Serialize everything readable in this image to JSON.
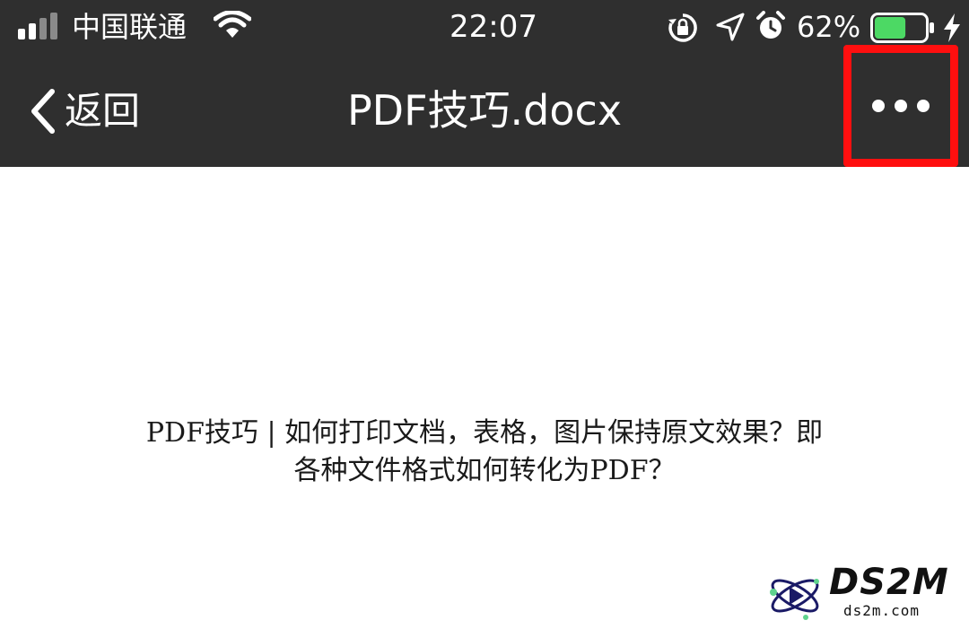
{
  "status_bar": {
    "carrier": "中国联通",
    "time": "22:07",
    "battery_percent": "62%",
    "battery_level": 0.62,
    "battery_color": "#4cd964",
    "icons": [
      "signal-icon",
      "wifi-icon",
      "orientation-lock-icon",
      "location-arrow-icon",
      "alarm-icon",
      "battery-icon",
      "charging-bolt-icon"
    ]
  },
  "nav": {
    "back_label": "返回",
    "title": "PDF技巧.docx",
    "more_icon": "ellipsis-icon",
    "highlight_color": "#ff0f0f"
  },
  "document": {
    "text": "PDF技巧 | 如何打印文档，表格，图片保持原文效果？即各种文件格式如何转化为PDF？"
  },
  "watermark": {
    "brand": "DS2M",
    "site": "ds2m.com"
  }
}
